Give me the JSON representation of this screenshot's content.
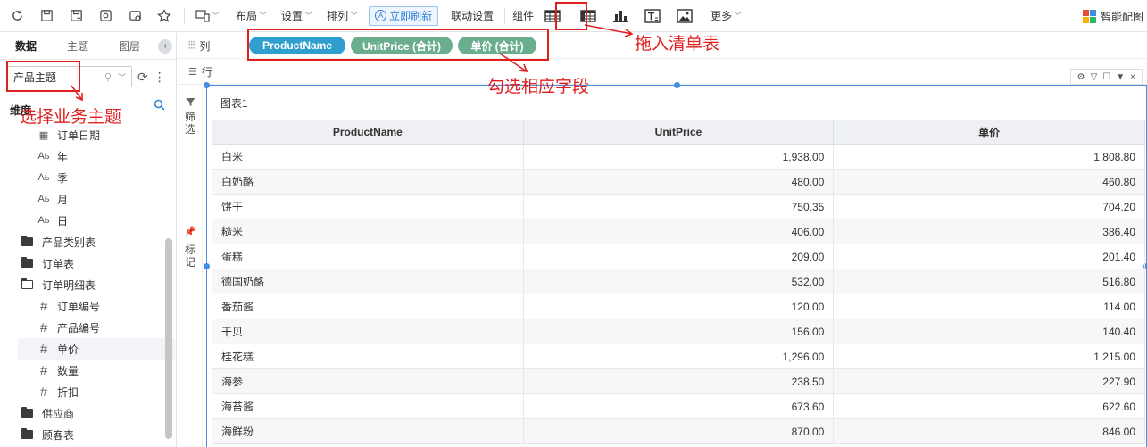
{
  "toolbar": {
    "layout_label": "布局",
    "settings_label": "设置",
    "arrange_label": "排列",
    "refresh_label": "立即刷新",
    "linkage_label": "联动设置",
    "component_label": "组件",
    "more_label": "更多",
    "smart_label": "智能配图"
  },
  "left_panel": {
    "tabs": [
      "数据",
      "主题",
      "图层"
    ],
    "theme_value": "产品主题",
    "dimension_label": "维度",
    "tree": [
      {
        "type": "date",
        "icon": "calendar-icon",
        "label": "订单日期",
        "indent": 42
      },
      {
        "type": "text",
        "icon": "text-type-icon",
        "label": "年",
        "indent": 42
      },
      {
        "type": "text",
        "icon": "text-type-icon",
        "label": "季",
        "indent": 42
      },
      {
        "type": "text",
        "icon": "text-type-icon",
        "label": "月",
        "indent": 42
      },
      {
        "type": "text",
        "icon": "text-type-icon",
        "label": "日",
        "indent": 42
      },
      {
        "type": "folder",
        "icon": "folder-icon",
        "label": "产品类别表",
        "indent": 24
      },
      {
        "type": "folder",
        "icon": "folder-icon",
        "label": "订单表",
        "indent": 24
      },
      {
        "type": "folder-open",
        "icon": "folder-open-icon",
        "label": "订单明细表",
        "indent": 24
      },
      {
        "type": "num",
        "icon": "hash-icon",
        "label": "订单编号",
        "indent": 42
      },
      {
        "type": "num",
        "icon": "hash-icon",
        "label": "产品编号",
        "indent": 42
      },
      {
        "type": "num",
        "icon": "hash-icon",
        "label": "单价",
        "indent": 42,
        "highlight": true
      },
      {
        "type": "num",
        "icon": "hash-icon",
        "label": "数量",
        "indent": 42
      },
      {
        "type": "num",
        "icon": "hash-icon",
        "label": "折扣",
        "indent": 42
      },
      {
        "type": "folder",
        "icon": "folder-icon",
        "label": "供应商",
        "indent": 24
      },
      {
        "type": "folder",
        "icon": "folder-icon",
        "label": "顾客表",
        "indent": 24
      }
    ]
  },
  "shelf": {
    "column_label": "列",
    "row_label": "行",
    "pills": [
      {
        "label": "ProductName",
        "color": "blue"
      },
      {
        "label": "UnitPrice (合计)",
        "color": "green"
      },
      {
        "label": "单价 (合计)",
        "color": "green"
      }
    ]
  },
  "filter_label": "筛选",
  "mark_label": "标记",
  "chart": {
    "title": "图表1",
    "headers": [
      "ProductName",
      "UnitPrice",
      "单价"
    ],
    "rows": [
      [
        "白米",
        "1,938.00",
        "1,808.80"
      ],
      [
        "白奶酪",
        "480.00",
        "460.80"
      ],
      [
        "饼干",
        "750.35",
        "704.20"
      ],
      [
        "糙米",
        "406.00",
        "386.40"
      ],
      [
        "蛋糕",
        "209.00",
        "201.40"
      ],
      [
        "德国奶酪",
        "532.00",
        "516.80"
      ],
      [
        "番茄酱",
        "120.00",
        "114.00"
      ],
      [
        "干贝",
        "156.00",
        "140.40"
      ],
      [
        "桂花糕",
        "1,296.00",
        "1,215.00"
      ],
      [
        "海参",
        "238.50",
        "227.90"
      ],
      [
        "海苔酱",
        "673.60",
        "622.60"
      ],
      [
        "海鲜粉",
        "870.00",
        "846.00"
      ]
    ]
  },
  "annotations": {
    "drag_table": "拖入清单表",
    "check_fields": "勾选相应字段",
    "select_theme": "选择业务主题"
  },
  "colors": {
    "accent": "#2f7fd8",
    "annotation": "#e02020",
    "pill_blue": "#2e9fcf",
    "pill_green": "#6aae8e"
  }
}
